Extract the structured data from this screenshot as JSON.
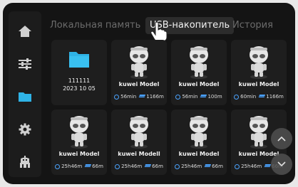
{
  "tabs": [
    {
      "label": "Локальная память",
      "active": false
    },
    {
      "label": "USB-накопитель",
      "active": true
    },
    {
      "label": "История",
      "active": false
    }
  ],
  "sidebar": {
    "items": [
      {
        "icon": "home-icon"
      },
      {
        "icon": "sliders-icon"
      },
      {
        "icon": "folder-icon",
        "active": true
      },
      {
        "icon": "gear-icon"
      },
      {
        "icon": "robot-icon"
      }
    ]
  },
  "folder": {
    "name": "111111",
    "date": "2023 10 05"
  },
  "files": [
    {
      "name": "kuwei Model",
      "time": "56min",
      "layers": "1166m"
    },
    {
      "name": "kuwei Model",
      "time": "56min",
      "layers": "100m"
    },
    {
      "name": "kuwei Model",
      "time": "60min",
      "layers": "1166m"
    },
    {
      "name": "kuwei Model",
      "time": "25h46m",
      "layers": "66m"
    },
    {
      "name": "kuwei Modell",
      "time": "25h46m",
      "layers": "66m"
    },
    {
      "name": "kuwei Model",
      "time": "25h46m",
      "layers": "66m"
    },
    {
      "name": "kuwei Model",
      "time": "25h46m",
      "layers": "66m"
    }
  ],
  "colors": {
    "accent": "#4aa3ff",
    "folder": "#2fb3e6",
    "background": "#141414",
    "card": "#1e1e1e"
  }
}
